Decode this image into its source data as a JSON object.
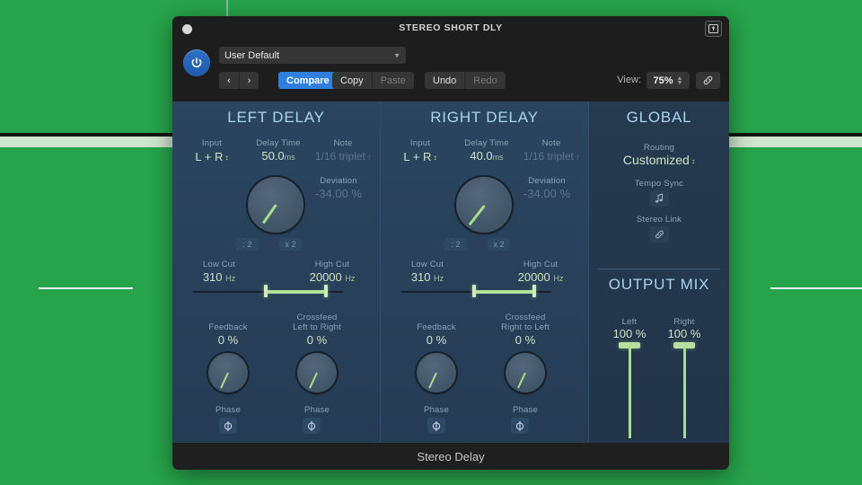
{
  "window": {
    "title": "STEREO SHORT DLY",
    "footer_title": "Stereo Delay",
    "close_icon": "close-dot",
    "expand_icon": "expand-window-icon"
  },
  "toolbar": {
    "power_icon": "power-icon",
    "preset_value": "User Default",
    "preset_chevron": "chevron-down-icon",
    "prev_label": "‹",
    "next_label": "›",
    "compare_label": "Compare",
    "copy_label": "Copy",
    "paste_label": "Paste",
    "undo_label": "Undo",
    "redo_label": "Redo",
    "view_label": "View:",
    "view_value": "75%",
    "link_icon": "link-icon"
  },
  "left_delay": {
    "title": "LEFT DELAY",
    "input_label": "Input",
    "input_value": "L + R",
    "delay_time_label": "Delay Time",
    "delay_time_value": "50.0",
    "delay_time_unit": "ms",
    "note_label": "Note",
    "note_value": "1/16 triplet",
    "deviation_label": "Deviation",
    "deviation_value": "-34.00 %",
    "divide_label": ": 2",
    "multiply_label": "x 2",
    "low_cut_label": "Low Cut",
    "low_cut_value": "310",
    "low_cut_unit": "Hz",
    "high_cut_label": "High Cut",
    "high_cut_value": "20000",
    "high_cut_unit": "Hz",
    "feedback_label": "Feedback",
    "feedback_value": "0 %",
    "crossfeed_label_1": "Crossfeed",
    "crossfeed_label_2": "Left to Right",
    "crossfeed_value": "0 %",
    "phase_label": "Phase",
    "phase_icon": "phase-invert-icon"
  },
  "right_delay": {
    "title": "RIGHT DELAY",
    "input_label": "Input",
    "input_value": "L + R",
    "delay_time_label": "Delay Time",
    "delay_time_value": "40.0",
    "delay_time_unit": "ms",
    "note_label": "Note",
    "note_value": "1/16 triplet",
    "deviation_label": "Deviation",
    "deviation_value": "-34.00 %",
    "divide_label": ": 2",
    "multiply_label": "x 2",
    "low_cut_label": "Low Cut",
    "low_cut_value": "310",
    "low_cut_unit": "Hz",
    "high_cut_label": "High Cut",
    "high_cut_value": "20000",
    "high_cut_unit": "Hz",
    "feedback_label": "Feedback",
    "feedback_value": "0 %",
    "crossfeed_label_1": "Crossfeed",
    "crossfeed_label_2": "Right to Left",
    "crossfeed_value": "0 %",
    "phase_label": "Phase",
    "phase_icon": "phase-invert-icon"
  },
  "global": {
    "title": "GLOBAL",
    "routing_label": "Routing",
    "routing_value": "Customized",
    "tempo_sync_label": "Tempo Sync",
    "tempo_sync_icon": "music-note-icon",
    "stereo_link_label": "Stereo Link",
    "stereo_link_icon": "link-icon"
  },
  "output_mix": {
    "title": "OUTPUT MIX",
    "left_label": "Left",
    "left_value": "100 %",
    "right_label": "Right",
    "right_value": "100 %"
  },
  "colors": {
    "desktop_green": "#27a44b",
    "accent_blue": "#2f7fe0",
    "panel_blue": "#2b4560",
    "value_green": "#cfe3c4",
    "title_blue": "#a9d4ee"
  }
}
